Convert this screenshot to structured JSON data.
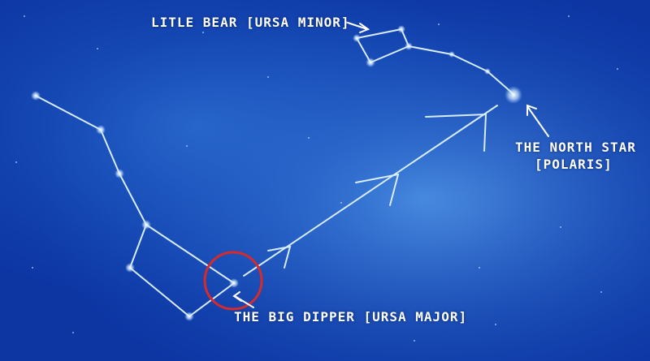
{
  "labels": {
    "little_bear": "LITLE BEAR [URSA MINOR]",
    "north_star_line1": "THE NORTH STAR",
    "north_star_line2": "[POLARIS]",
    "big_dipper": "THE BIG DIPPER [URSA MAJOR]"
  },
  "colors": {
    "sky_dark": "#0a2e8f",
    "sky_mid": "#1756c4",
    "sky_light": "#5aa0ee",
    "line": "#d8ecff",
    "highlight_circle": "#d92a2a",
    "text": "#ffffff"
  }
}
